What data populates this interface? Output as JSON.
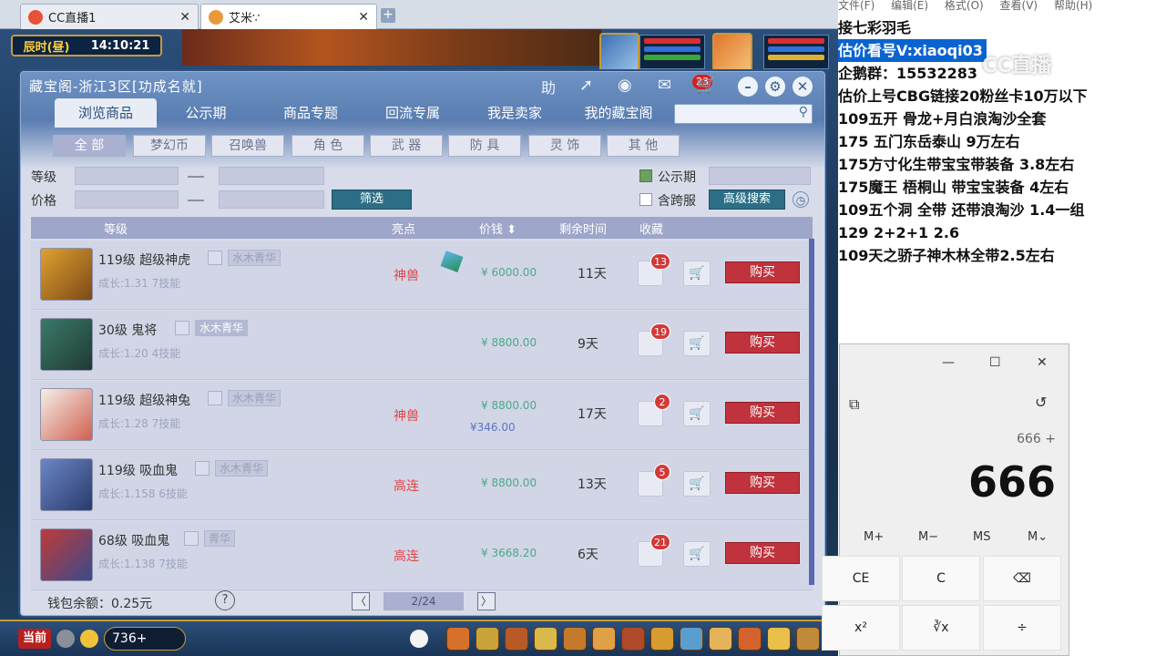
{
  "browser": {
    "tabs": [
      {
        "title": "CC直播1",
        "close": "✕"
      },
      {
        "title": "艾米∵",
        "close": "✕"
      }
    ],
    "new_tab": "+"
  },
  "game": {
    "clock_period": "辰时(昼)",
    "clock_time": "14:10:21",
    "bottom": {
      "channel": "当前",
      "count": "736+"
    }
  },
  "cbg": {
    "title": "藏宝阁-浙江3区[功成名就]",
    "top_icons": {
      "help": "助",
      "msg_badge": "23"
    },
    "nav_tabs": [
      "浏览商品",
      "公示期",
      "商品专题",
      "回流专属",
      "我是卖家",
      "我的藏宝阁"
    ],
    "categories": [
      "全 部",
      "梦幻币",
      "召唤兽",
      "角 色",
      "武 器",
      "防 具",
      "灵 饰",
      "其 他"
    ],
    "filter": {
      "level_label": "等级",
      "price_label": "价格",
      "filter_button": "筛选",
      "public_label": "公示期",
      "cross_label": "含跨服",
      "advanced_button": "高级搜索"
    },
    "table_headers": {
      "level": "等级",
      "highlight": "亮点",
      "price": "价钱 ⬍",
      "remaining": "剩余时间",
      "collect": "收藏"
    },
    "rows": [
      {
        "name": "119级 超级神虎",
        "tag": "水木青华",
        "sub": "成长:1.31 7技能",
        "highlight": "神兽",
        "price": "¥ 6000.00",
        "price2": "",
        "time": "11天",
        "fav": "13",
        "buy": "购买"
      },
      {
        "name": "30级 鬼将",
        "tag": "水木青华",
        "sub": "成长:1.20 4技能",
        "highlight": "",
        "price": "¥ 8800.00",
        "price2": "",
        "time": "9天",
        "fav": "19",
        "buy": "购买"
      },
      {
        "name": "119级 超级神兔",
        "tag": "水木青华",
        "sub": "成长:1.28 7技能",
        "highlight": "神兽",
        "price": "¥ 8800.00",
        "price2": "¥346.00",
        "time": "17天",
        "fav": "2",
        "buy": "购买"
      },
      {
        "name": "119级 吸血鬼",
        "tag": "水木青华",
        "sub": "成长:1.158 6技能",
        "highlight": "高连",
        "price": "¥ 8800.00",
        "price2": "",
        "time": "13天",
        "fav": "5",
        "buy": "购买"
      },
      {
        "name": "68级 吸血鬼",
        "tag": "青华",
        "sub": "成长:1.138 7技能",
        "highlight": "高连",
        "price": "¥ 3668.20",
        "price2": "",
        "time": "6天",
        "fav": "21",
        "buy": "购买"
      }
    ],
    "footer": {
      "wallet": "钱包余额：0.25元",
      "help": "?",
      "prev": "〈",
      "page": "2/24",
      "next": "〉"
    }
  },
  "notepad": {
    "menu": [
      "文件(F)",
      "编辑(E)",
      "格式(O)",
      "查看(V)",
      "帮助(H)"
    ],
    "lines": [
      "   接七彩羽毛",
      "估价看号V:xiaoqi03",
      "企鹅群：15532283",
      "估价上号CBG链接20粉丝卡10万以下",
      "109五开 骨龙+月白浪淘沙全套",
      "175 五门东岳泰山  9万左右",
      "175方寸化生带宝宝带装备  3.8左右",
      "175魔王 梧桐山  带宝宝装备 4左右",
      "109五个洞 全带 还带浪淘沙  1.4一组",
      "129 2+2+1  2.6",
      "109天之骄子神木林全带2.5左右"
    ]
  },
  "calculator": {
    "title_buttons": [
      "—",
      "☐",
      "✕"
    ],
    "expression": "666 +",
    "display": "666",
    "memory": [
      "M+",
      "M−",
      "MS",
      "M⌄"
    ],
    "keys": [
      "CE",
      "C",
      "⌫",
      "x²",
      "∛x",
      "÷"
    ]
  },
  "watermark": "CC直播"
}
